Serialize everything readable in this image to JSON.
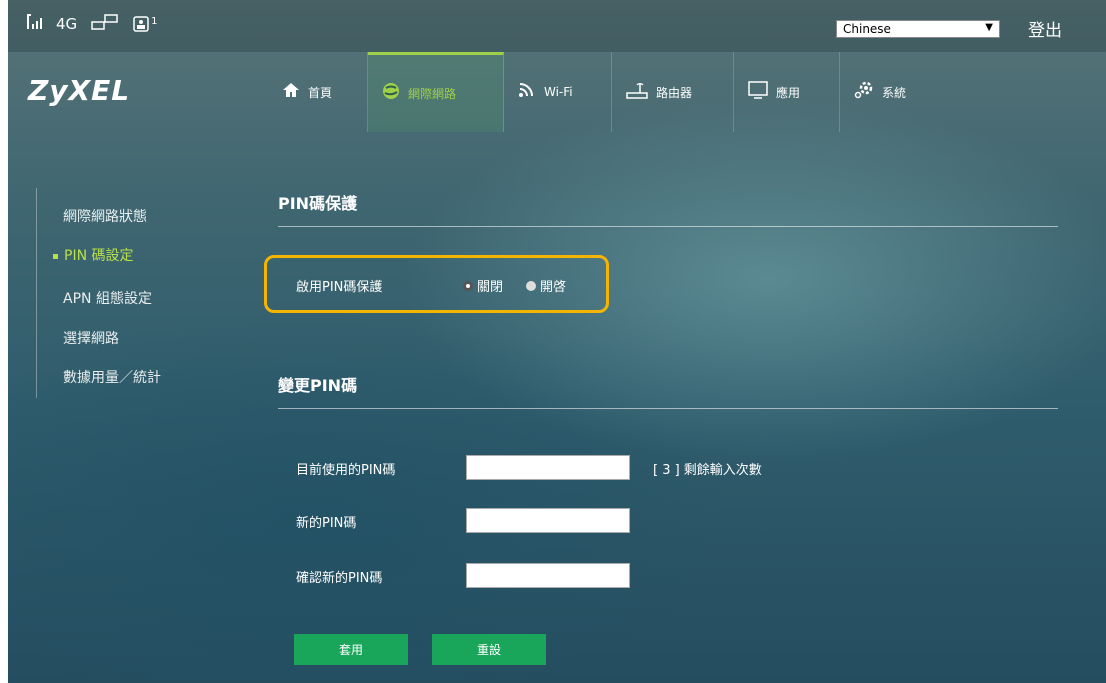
{
  "status": {
    "network_type": "4G",
    "sim_count": "1"
  },
  "language": {
    "selected": "Chinese"
  },
  "logout_label": "登出",
  "logo": "ZyXEL",
  "nav": [
    {
      "label": "首頁",
      "icon": "home-icon"
    },
    {
      "label": "網際網路",
      "icon": "globe-icon"
    },
    {
      "label": "Wi-Fi",
      "icon": "wifi-icon"
    },
    {
      "label": "路由器",
      "icon": "router-icon"
    },
    {
      "label": "應用",
      "icon": "monitor-icon"
    },
    {
      "label": "系統",
      "icon": "gear-icon"
    }
  ],
  "nav_active": "網際網路",
  "sidebar": [
    {
      "label": "網際網路狀態"
    },
    {
      "label": "PIN 碼設定"
    },
    {
      "label": "APN 組態設定"
    },
    {
      "label": "選擇網路"
    },
    {
      "label": "數據用量／統計"
    }
  ],
  "sidebar_active": "PIN 碼設定",
  "pin_protection": {
    "title": "PIN碼保護",
    "enable_label": "啟用PIN碼保護",
    "option_off": "關閉",
    "option_on": "開啓",
    "selected": "關閉"
  },
  "change_pin": {
    "title": "變更PIN碼",
    "current_label": "目前使用的PIN碼",
    "current_value": "",
    "remaining": "[ 3 ] 剩餘輸入次數",
    "new_label": "新的PIN碼",
    "new_value": "",
    "confirm_label": "確認新的PIN碼",
    "confirm_value": ""
  },
  "buttons": {
    "apply": "套用",
    "reset": "重設"
  },
  "colors": {
    "accent_green": "#19a65b",
    "highlight": "#f4b400",
    "active_text": "#b7e04a"
  }
}
